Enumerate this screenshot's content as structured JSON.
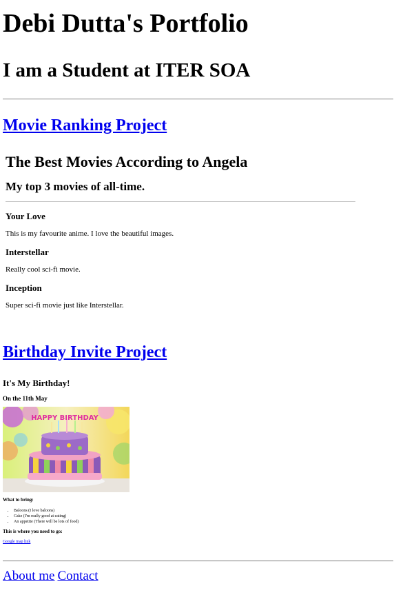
{
  "header": {
    "title": "Debi Dutta's Portfolio",
    "subtitle": "I am a Student at ITER SOA"
  },
  "movie_section": {
    "link_label": "Movie Ranking Project",
    "heading": "The Best Movies According to Angela",
    "subheading": "My top 3 movies of all-time.",
    "movies": [
      {
        "title": "Your Love",
        "description": "This is my favourite anime. I love the beautiful images."
      },
      {
        "title": "Interstellar",
        "description": "Really cool sci-fi movie."
      },
      {
        "title": "Inception",
        "description": "Super sci-fi movie just like Interstellar."
      }
    ]
  },
  "birthday_section": {
    "link_label": "Birthday Invite Project",
    "heading": "It's My Birthday!",
    "date": "On the 11th May",
    "image_text": "HAPPY BIRTHDAY",
    "bring_heading": "What to bring:",
    "bring_items": [
      "Baloons (I love baloons)",
      "Cake (I'm really good at eating)",
      "An appetite (There will be lots of food)"
    ],
    "where_heading": "This is where you need to go:",
    "map_link": "Google map link"
  },
  "footer": {
    "about_label": "About me",
    "contact_label": "Contact"
  }
}
